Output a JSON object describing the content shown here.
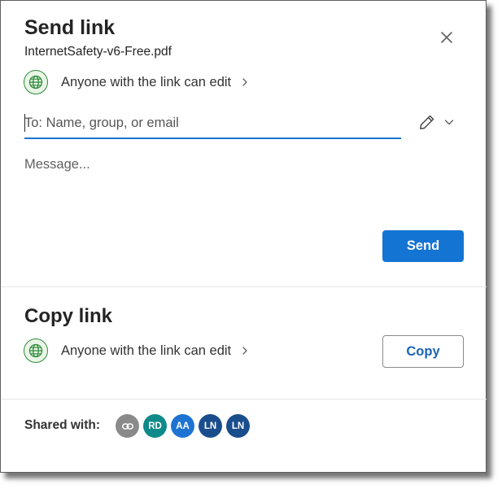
{
  "send_link": {
    "title": "Send link",
    "filename": "InternetSafety-v6-Free.pdf",
    "permission": "Anyone with the link can edit",
    "to_placeholder": "To: Name, group, or email",
    "message_placeholder": "Message...",
    "send_label": "Send"
  },
  "copy_link": {
    "title": "Copy link",
    "permission": "Anyone with the link can edit",
    "copy_label": "Copy"
  },
  "shared_with": {
    "label": "Shared with:",
    "avatars": [
      {
        "initials": "",
        "icon": "link-icon",
        "color": "#8a8a8a"
      },
      {
        "initials": "RD",
        "color": "#0f8a8a"
      },
      {
        "initials": "AA",
        "color": "#1e73d2"
      },
      {
        "initials": "LN",
        "color": "#1a4d8c"
      },
      {
        "initials": "LN",
        "color": "#1a4d8c"
      }
    ]
  },
  "colors": {
    "accent": "#1474d4",
    "globe_green": "#2f8a3b"
  }
}
